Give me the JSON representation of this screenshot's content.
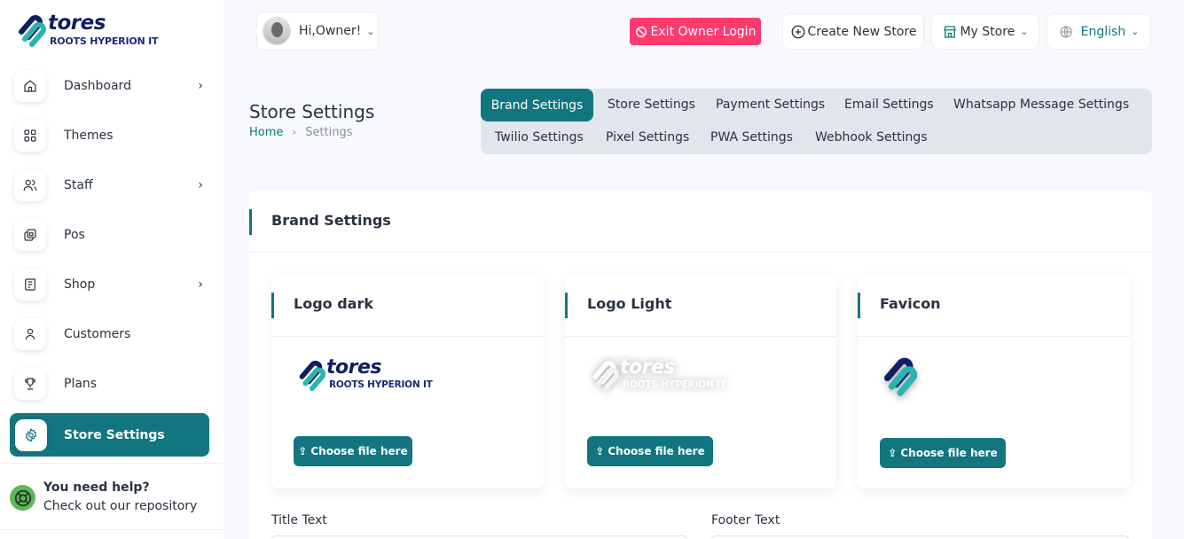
{
  "brand": {
    "word": "tores",
    "tagline": "ROOTS HYPERION IT"
  },
  "sidebar": {
    "items": [
      {
        "label": "Dashboard",
        "icon": "home-icon",
        "has_children": true
      },
      {
        "label": "Themes",
        "icon": "grid-icon",
        "has_children": false
      },
      {
        "label": "Staff",
        "icon": "users-icon",
        "has_children": true
      },
      {
        "label": "Pos",
        "icon": "layers-icon",
        "has_children": false
      },
      {
        "label": "Shop",
        "icon": "receipt-icon",
        "has_children": true
      },
      {
        "label": "Customers",
        "icon": "user-icon",
        "has_children": false
      },
      {
        "label": "Plans",
        "icon": "trophy-icon",
        "has_children": false
      },
      {
        "label": "Store Settings",
        "icon": "gear-icon",
        "has_children": false,
        "active": true
      }
    ],
    "help": {
      "title": "You need help?",
      "subtitle": "Check out our repository"
    }
  },
  "header": {
    "user_greeting": "Hi,Owner!",
    "exit_owner_login": "Exit Owner Login",
    "create_store": "Create New Store",
    "my_store": "My Store",
    "language": "English"
  },
  "page": {
    "title": "Store Settings",
    "breadcrumb": {
      "home": "Home",
      "current": "Settings"
    }
  },
  "tabs": [
    {
      "label": "Brand Settings",
      "active": true
    },
    {
      "label": "Store Settings"
    },
    {
      "label": "Payment Settings"
    },
    {
      "label": "Email Settings"
    },
    {
      "label": "Whatsapp Message Settings"
    },
    {
      "label": "Twilio Settings"
    },
    {
      "label": "Pixel Settings"
    },
    {
      "label": "PWA Settings"
    },
    {
      "label": "Webhook Settings"
    }
  ],
  "brand_settings": {
    "title": "Brand Settings",
    "cards": [
      {
        "title": "Logo dark",
        "button": "Choose file here"
      },
      {
        "title": "Logo Light",
        "button": "Choose file here"
      },
      {
        "title": "Favicon",
        "button": "Choose file here"
      }
    ],
    "fields": {
      "title_text_label": "Title Text",
      "footer_text_label": "Footer Text"
    }
  },
  "colors": {
    "accent": "#11767f",
    "danger": "#ff3a6e",
    "brand_navy": "#0f1f63",
    "brand_teal": "#2bb3b0"
  }
}
